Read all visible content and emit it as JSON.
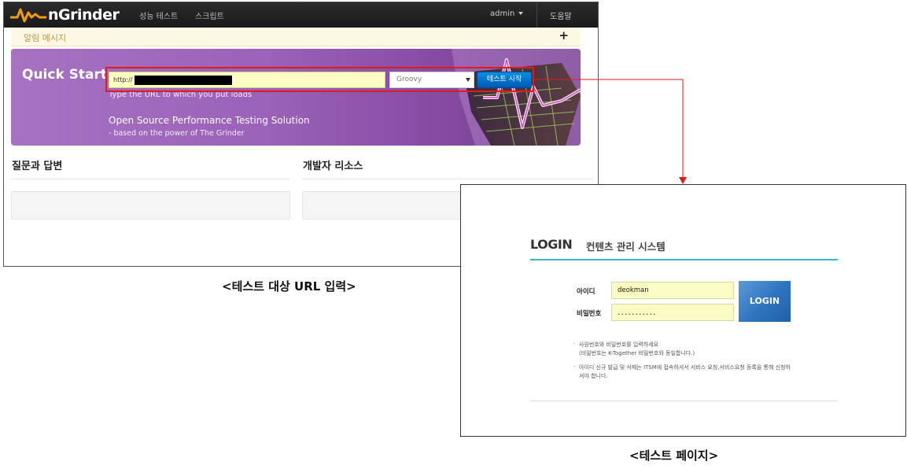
{
  "left_screen": {
    "nav": {
      "brand": "nGrinder",
      "menu_performance_test": "성능 테스트",
      "menu_script": "스크립트",
      "user": "admin",
      "help": "도움말"
    },
    "alert": {
      "title": "알림 메시지",
      "toggle": "+"
    },
    "quick_start": {
      "title": "Quick Start",
      "url_value": "http://",
      "script_type_selected": "Groovy",
      "start_button": "테스트 시작",
      "hint": "Type the URL to which you put loads",
      "tagline": "Open Source Performance Testing Solution",
      "tagline_sub": "- based on the power of The Grinder"
    },
    "sections": {
      "qa_title": "질문과 답변",
      "dev_resources_title": "개발자 리소스"
    }
  },
  "right_screen": {
    "title": "LOGIN",
    "subtitle": "컨텐츠 관리 시스템",
    "id_label": "아이디",
    "id_value": "deokman",
    "password_label": "비밀번호",
    "password_value": "...........",
    "login_button": "LOGIN",
    "notes": [
      "사원번호와 비밀번호를 입력하세요\n(비밀번호는 K-Together 비밀번호와 동일합니다.)",
      "아이디 신규 발급 및 삭제는 ITSM에 접속하셔서 서비스 요청,서비스요청 등록을 통해 신청하셔야 합니다."
    ],
    "bullet": "·"
  },
  "captions": {
    "left": "<테스트 대상 URL 입력>",
    "right": "<테스트 페이지>"
  },
  "colors": {
    "highlight_red": "#e21a1a",
    "ngrinder_purple": "#9a62b8",
    "start_button_blue": "#0a78d0",
    "input_yellow": "#fbfcc4",
    "login_teal_rule": "#38b7c8",
    "login_button_blue": "#2e73bf"
  }
}
